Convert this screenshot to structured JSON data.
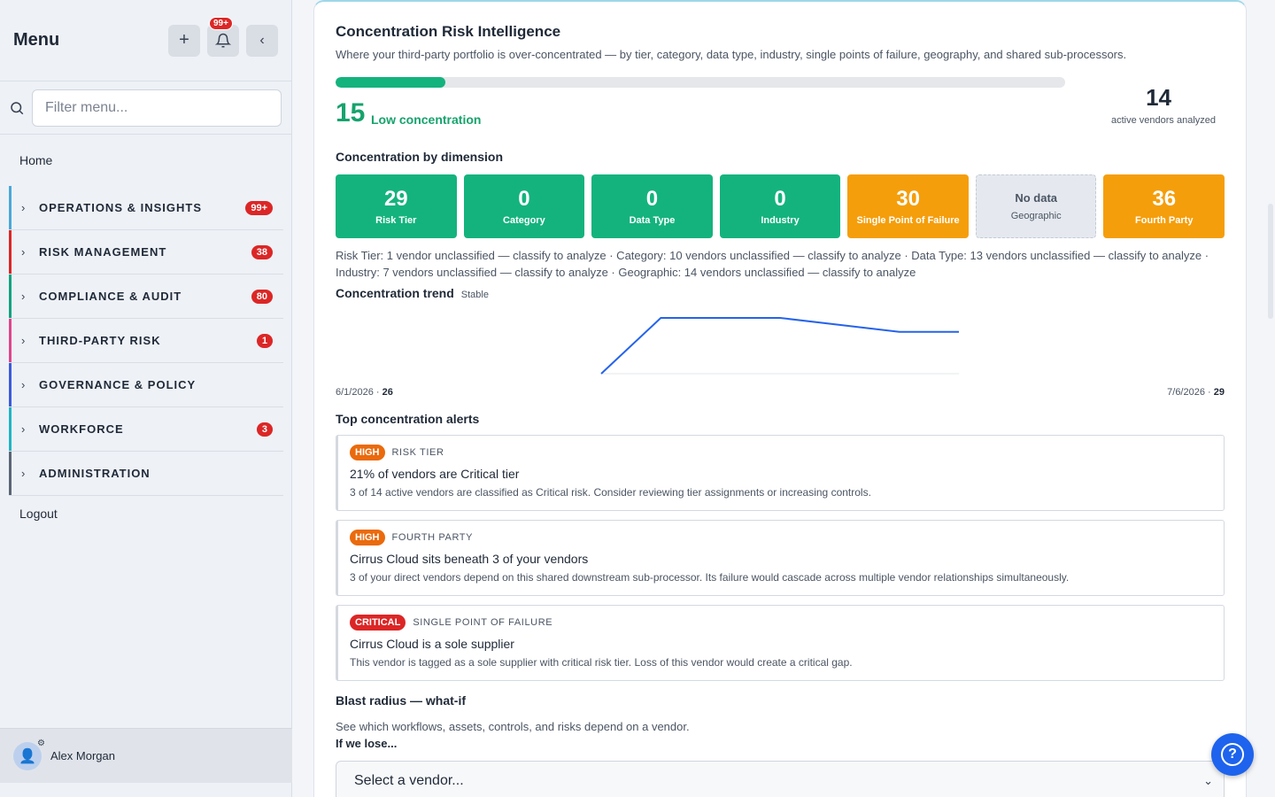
{
  "sidebar": {
    "title": "Menu",
    "notification_badge": "99+",
    "filter_placeholder": "Filter menu...",
    "home": "Home",
    "groups": [
      {
        "label": "OPERATIONS & INSIGHTS",
        "count": "99+",
        "color": "#4aa8d8"
      },
      {
        "label": "RISK MANAGEMENT",
        "count": "38",
        "color": "#dc2626"
      },
      {
        "label": "COMPLIANCE & AUDIT",
        "count": "80",
        "color": "#10a37f"
      },
      {
        "label": "THIRD-PARTY RISK",
        "count": "1",
        "color": "#e0458a"
      },
      {
        "label": "GOVERNANCE & POLICY",
        "count": "",
        "color": "#3b5bdb"
      },
      {
        "label": "WORKFORCE",
        "count": "3",
        "color": "#1fb5c4"
      },
      {
        "label": "ADMINISTRATION",
        "count": "",
        "color": "#5b6577"
      }
    ],
    "logout": "Logout",
    "user": {
      "name": "Alex Morgan"
    }
  },
  "main": {
    "title": "Concentration Risk Intelligence",
    "subtitle": "Where your third-party portfolio is over-concentrated — by tier, category, data type, industry, single points of failure, geography, and shared sub-processors.",
    "score": {
      "value": "15",
      "label": "Low concentration",
      "progress_pct": 15
    },
    "vendors": {
      "value": "14",
      "label": "active vendors analyzed"
    },
    "dimension_title": "Concentration by dimension",
    "dimensions": [
      {
        "value": "29",
        "label": "Risk Tier",
        "style": "green"
      },
      {
        "value": "0",
        "label": "Category",
        "style": "green"
      },
      {
        "value": "0",
        "label": "Data Type",
        "style": "green"
      },
      {
        "value": "0",
        "label": "Industry",
        "style": "green"
      },
      {
        "value": "30",
        "label": "Single Point of Failure",
        "style": "orange"
      },
      {
        "value": "No data",
        "label": "Geographic",
        "style": "nodata"
      },
      {
        "value": "36",
        "label": "Fourth Party",
        "style": "orange"
      }
    ],
    "unclassified_note": "Risk Tier: 1 vendor unclassified — classify to analyze · Category: 10 vendors unclassified — classify to analyze · Data Type: 13 vendors unclassified — classify to analyze · Industry: 7 vendors unclassified — classify to analyze · Geographic: 14 vendors unclassified — classify to analyze",
    "trend": {
      "title": "Concentration trend",
      "status": "Stable",
      "start_date": "6/1/2026",
      "start_value": "26",
      "end_date": "7/6/2026",
      "end_value": "29",
      "points": [
        26,
        30,
        30,
        30,
        29.5,
        29,
        29
      ]
    },
    "alerts_title": "Top concentration alerts",
    "alerts": [
      {
        "severity": "HIGH",
        "sev_class": "high",
        "category": "RISK TIER",
        "title": "21% of vendors are Critical tier",
        "description": "3 of 14 active vendors are classified as Critical risk. Consider reviewing tier assignments or increasing controls."
      },
      {
        "severity": "HIGH",
        "sev_class": "high",
        "category": "FOURTH PARTY",
        "title": "Cirrus Cloud sits beneath 3 of your vendors",
        "description": "3 of your direct vendors depend on this shared downstream sub-processor. Its failure would cascade across multiple vendor relationships simultaneously."
      },
      {
        "severity": "CRITICAL",
        "sev_class": "critical",
        "category": "SINGLE POINT OF FAILURE",
        "title": "Cirrus Cloud is a sole supplier",
        "description": "This vendor is tagged as a sole supplier with critical risk tier. Loss of this vendor would create a critical gap."
      }
    ],
    "blast": {
      "title": "Blast radius — what-if",
      "subtitle": "See which workflows, assets, controls, and risks depend on a vendor.",
      "lose_label": "If we lose...",
      "select_value": "Select a vendor..."
    }
  },
  "colors": {
    "green": "#14b37d",
    "orange": "#f59e0b",
    "accent": "#1d63ed",
    "trend_line": "#2563eb"
  }
}
